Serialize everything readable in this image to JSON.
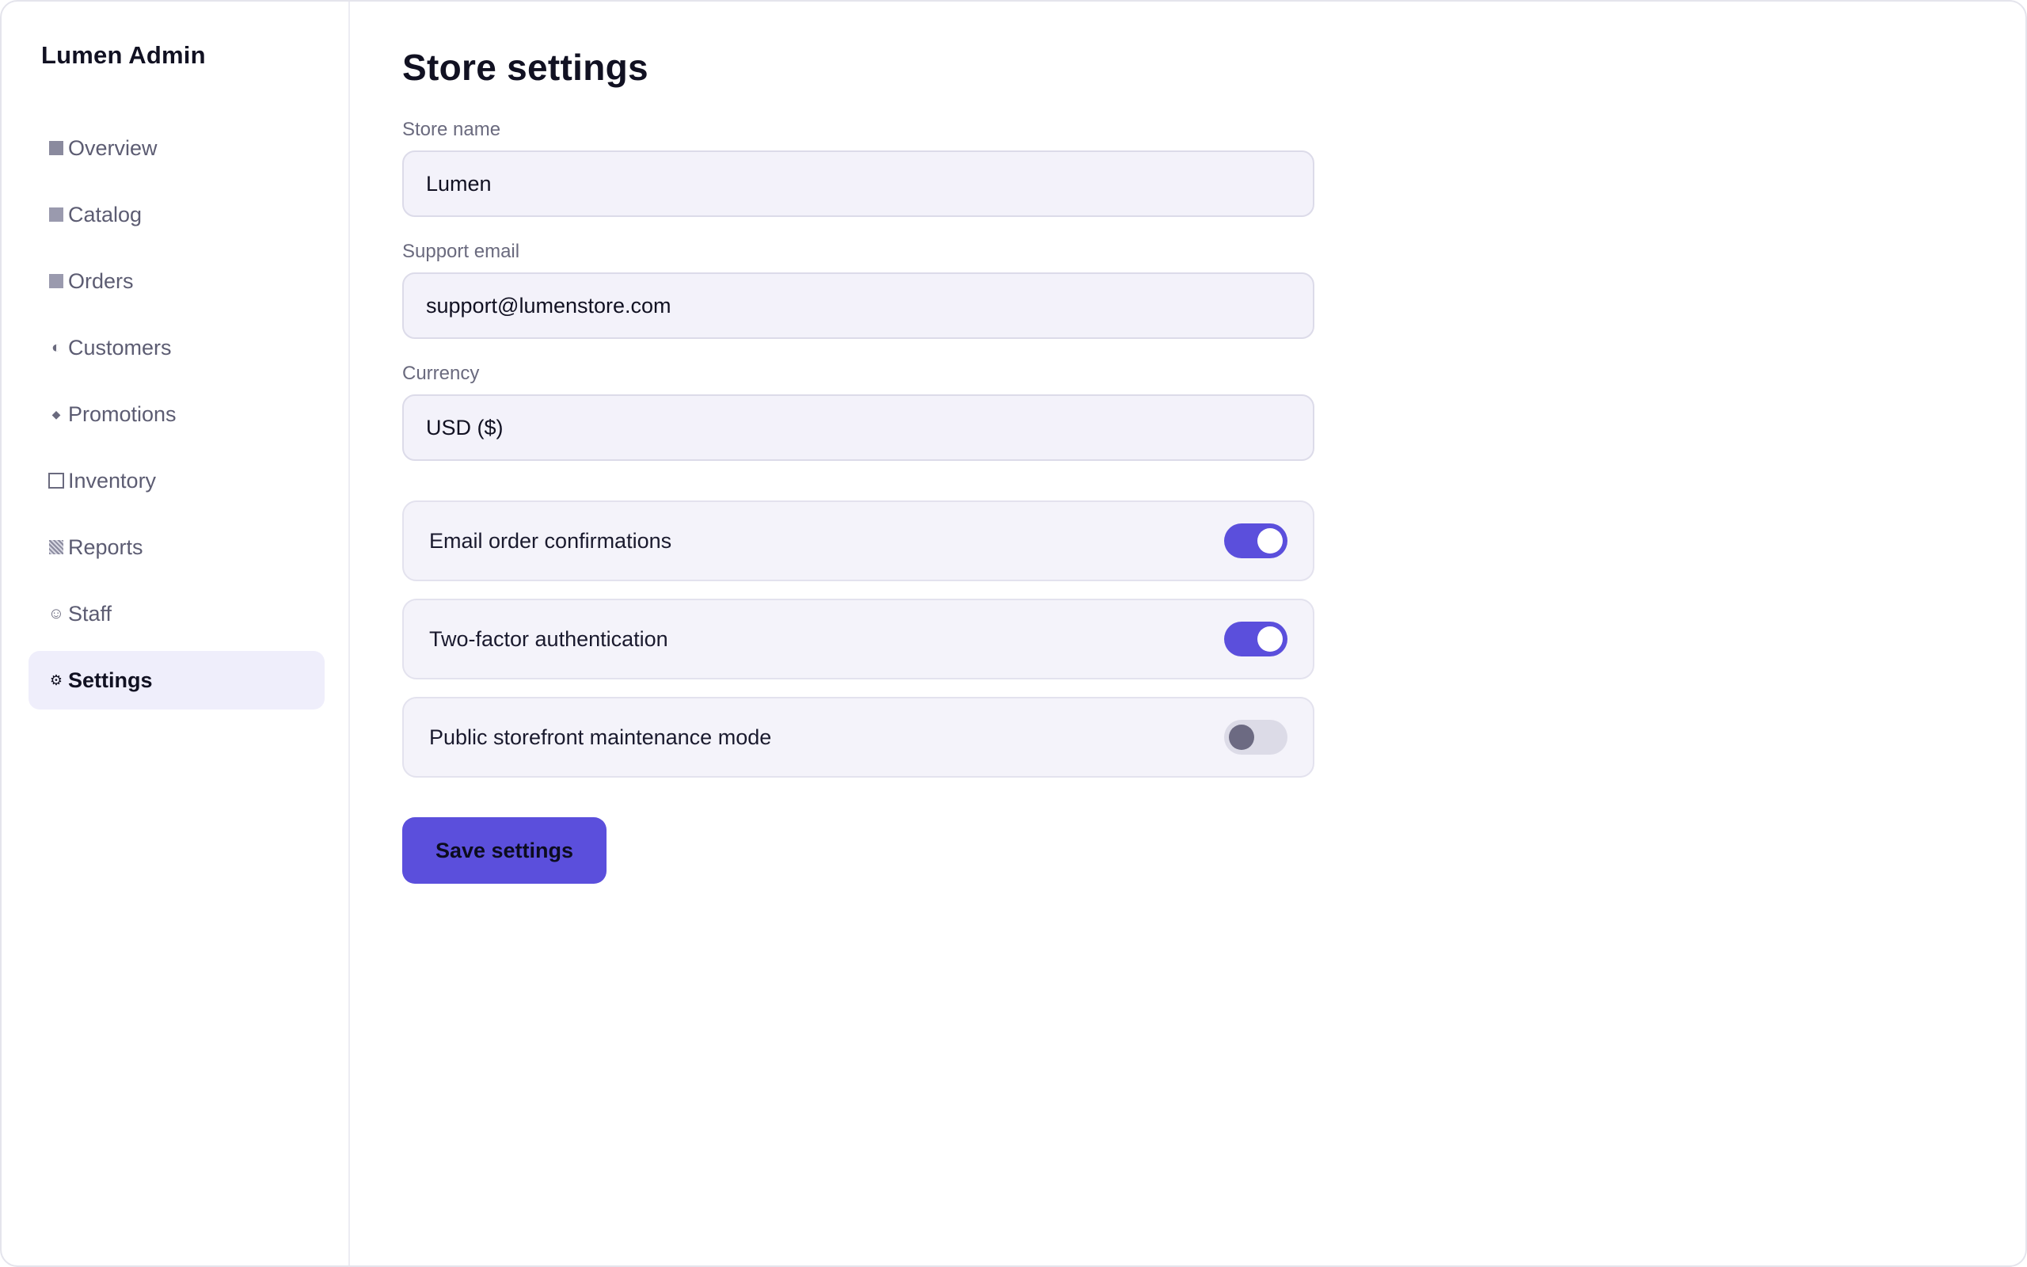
{
  "app": {
    "brand": "Lumen Admin"
  },
  "sidebar": {
    "items": [
      {
        "label": "Overview",
        "icon": "overview-icon",
        "active": false
      },
      {
        "label": "Catalog",
        "icon": "catalog-icon",
        "active": false
      },
      {
        "label": "Orders",
        "icon": "orders-icon",
        "active": false
      },
      {
        "label": "Customers",
        "icon": "customers-icon",
        "active": false
      },
      {
        "label": "Promotions",
        "icon": "promotions-icon",
        "active": false
      },
      {
        "label": "Inventory",
        "icon": "inventory-icon",
        "active": false
      },
      {
        "label": "Reports",
        "icon": "reports-icon",
        "active": false
      },
      {
        "label": "Staff",
        "icon": "staff-icon",
        "active": false
      },
      {
        "label": "Settings",
        "icon": "gear-icon",
        "active": true
      }
    ]
  },
  "main": {
    "title": "Store settings",
    "fields": {
      "store_name": {
        "label": "Store name",
        "value": "Lumen"
      },
      "support_email": {
        "label": "Support email",
        "value": "support@lumenstore.com"
      },
      "currency": {
        "label": "Currency",
        "value": "USD ($)"
      }
    },
    "toggles": [
      {
        "label": "Email order confirmations",
        "on": true
      },
      {
        "label": "Two-factor authentication",
        "on": true
      },
      {
        "label": "Public storefront maintenance mode",
        "on": false
      }
    ],
    "save_label": "Save settings"
  },
  "colors": {
    "accent": "#5b4fdc",
    "active_nav_bg": "#efeefb",
    "field_bg": "#f3f2fa",
    "toggle_off": "#dcdbe7"
  }
}
